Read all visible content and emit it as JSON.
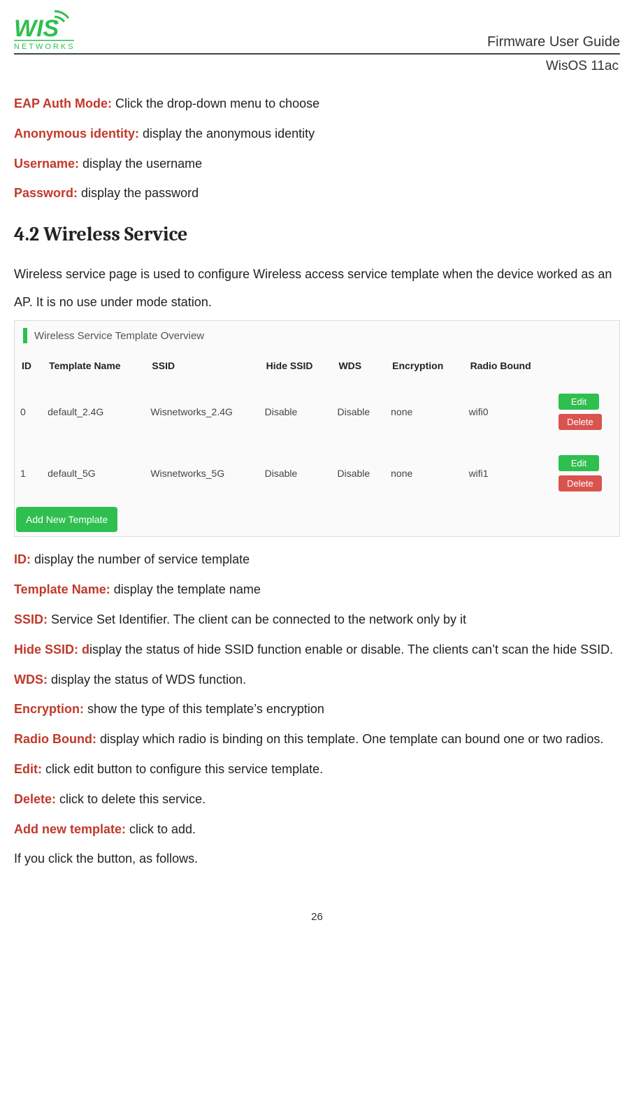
{
  "header": {
    "title": "Firmware User Guide",
    "subtitle": "WisOS 11ac",
    "logo_main": "WIS",
    "logo_sub": "NETWORKS"
  },
  "top_defs": [
    {
      "term": "EAP Auth Mode:",
      "desc": " Click the drop-down menu to choose"
    },
    {
      "term": "Anonymous identity:",
      "desc": " display the anonymous identity"
    },
    {
      "term": "Username:",
      "desc": " display the username"
    },
    {
      "term": "Password:",
      "desc": " display the password"
    }
  ],
  "section_heading": "4.2 Wireless Service",
  "intro_paragraph": "Wireless service page is used to configure Wireless access service template when the device worked as an AP. It is no use under mode station.",
  "panel": {
    "title": "Wireless Service Template Overview",
    "columns": [
      "ID",
      "Template Name",
      "SSID",
      "Hide SSID",
      "WDS",
      "Encryption",
      "Radio Bound",
      ""
    ],
    "rows": [
      {
        "id": "0",
        "template_name": "default_2.4G",
        "ssid": "Wisnetworks_2.4G",
        "hide_ssid": "Disable",
        "wds": "Disable",
        "encryption": "none",
        "radio_bound": "wifi0",
        "edit": "Edit",
        "delete": "Delete"
      },
      {
        "id": "1",
        "template_name": "default_5G",
        "ssid": "Wisnetworks_5G",
        "hide_ssid": "Disable",
        "wds": "Disable",
        "encryption": "none",
        "radio_bound": "wifi1",
        "edit": "Edit",
        "delete": "Delete"
      }
    ],
    "add_button": "Add New Template"
  },
  "bottom_defs": [
    {
      "term": "ID:",
      "desc": " display the number of service template"
    },
    {
      "term": "Template Name:",
      "desc": " display the template name"
    },
    {
      "term": "SSID:",
      "desc": " Service Set Identifier. The client can be connected to the network only by it"
    },
    {
      "term": "Hide SSID: d",
      "desc": "isplay the status of hide SSID function enable or disable. The clients can’t scan the hide SSID."
    },
    {
      "term": "WDS:",
      "desc": " display the status of WDS function."
    },
    {
      "term": "Encryption:",
      "desc": " show the type of this template’s encryption"
    },
    {
      "term": "Radio Bound:",
      "desc": " display which radio is binding on this template. One template can bound one or two radios."
    },
    {
      "term": "Edit:",
      "desc": " click edit button to configure this service template."
    },
    {
      "term": "Delete:",
      "desc": " click to delete this service."
    },
    {
      "term": "Add new template:",
      "desc": " click to add."
    }
  ],
  "closing_line": "If you click the button, as follows.",
  "page_number": "26"
}
